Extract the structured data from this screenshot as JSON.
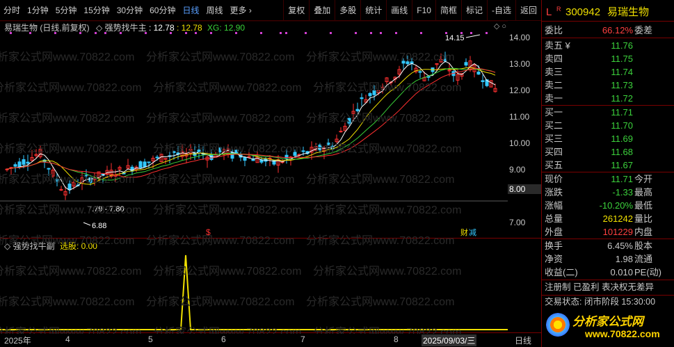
{
  "toolbar": {
    "left_items": [
      "分时",
      "1分钟",
      "5分钟",
      "15分钟",
      "30分钟",
      "60分钟",
      "日线",
      "周线",
      "更多 ›"
    ],
    "active_index": 6,
    "right_items": [
      "复权",
      "叠加",
      "多股",
      "统计",
      "画线",
      "F10",
      "简框",
      "标记",
      "-自选",
      "返回"
    ]
  },
  "chart_header": {
    "stock_label": "易瑞生物 (日线,前复权)",
    "indicator_name": "强势找牛主",
    "value1": ": 12.78",
    "value2": ": 12.78",
    "xg_label": "XG: 12.90"
  },
  "price_axis": {
    "ticks": [
      "14.00",
      "13.00",
      "12.00",
      "11.00",
      "10.00",
      "9.00",
      "8.00",
      "7.00"
    ],
    "highlight": "8.00"
  },
  "annotations": {
    "high_label": "14.15",
    "range_label": "7.79 - 7.80",
    "low_label": "6.88",
    "s_marker": "$",
    "report_marker": "财",
    "report_marker2": "减"
  },
  "sub_chart": {
    "indicator_name": "强势找牛副",
    "xuangu_label": "选股: 0.00"
  },
  "date_axis": {
    "labels": [
      "2025年",
      "4",
      "5",
      "6",
      "7",
      "8",
      "2025/09/03/三",
      "日线"
    ]
  },
  "panel": {
    "flag": "L",
    "r_mark": "R",
    "code": "300942",
    "name": "易瑞生物",
    "weibi_label": "委比",
    "weibi_value": "66.12%",
    "weicha_label": "委差",
    "asks": [
      {
        "label": "卖五 ¥",
        "price": "11.76"
      },
      {
        "label": "卖四",
        "price": "11.75"
      },
      {
        "label": "卖三",
        "price": "11.74"
      },
      {
        "label": "卖二",
        "price": "11.73"
      },
      {
        "label": "卖一",
        "price": "11.72"
      }
    ],
    "bids": [
      {
        "label": "买一",
        "price": "11.71"
      },
      {
        "label": "买二",
        "price": "11.70"
      },
      {
        "label": "买三",
        "price": "11.69"
      },
      {
        "label": "买四",
        "price": "11.68"
      },
      {
        "label": "买五",
        "price": "11.67"
      }
    ],
    "quote": [
      {
        "label": "现价",
        "value": "11.71",
        "label2": "今开",
        "color": "green"
      },
      {
        "label": "涨跌",
        "value": "-1.33",
        "label2": "最高",
        "color": "green"
      },
      {
        "label": "涨幅",
        "value": "-10.20%",
        "label2": "最低",
        "color": "green"
      },
      {
        "label": "总量",
        "value": "261242",
        "label2": "量比",
        "color": "yellow"
      },
      {
        "label": "外盘",
        "value": "101229",
        "label2": "内盘",
        "color": "red"
      }
    ],
    "stats": [
      {
        "label": "换手",
        "value": "6.45%",
        "label2": "股本"
      },
      {
        "label": "净资",
        "value": "1.98",
        "label2": "流通"
      },
      {
        "label": "收益(二)",
        "value": "0.010",
        "label2": "PE(动)"
      }
    ],
    "reg_line": "注册制 已盈利 表决权无差异",
    "trade_status": "交易状态: 闭市阶段 15:30:00",
    "logo_text": "分析家公式网",
    "logo_url": "www.70822.com"
  },
  "watermark": "分析家公式网www.70822.com",
  "colors": {
    "up": "#ff3030",
    "down": "#33c8ff",
    "ma5": "#ffffff",
    "ma10": "#f0e000",
    "ma20": "#38d038",
    "ma60": "#ff3030",
    "purple": "#d040d0"
  }
}
